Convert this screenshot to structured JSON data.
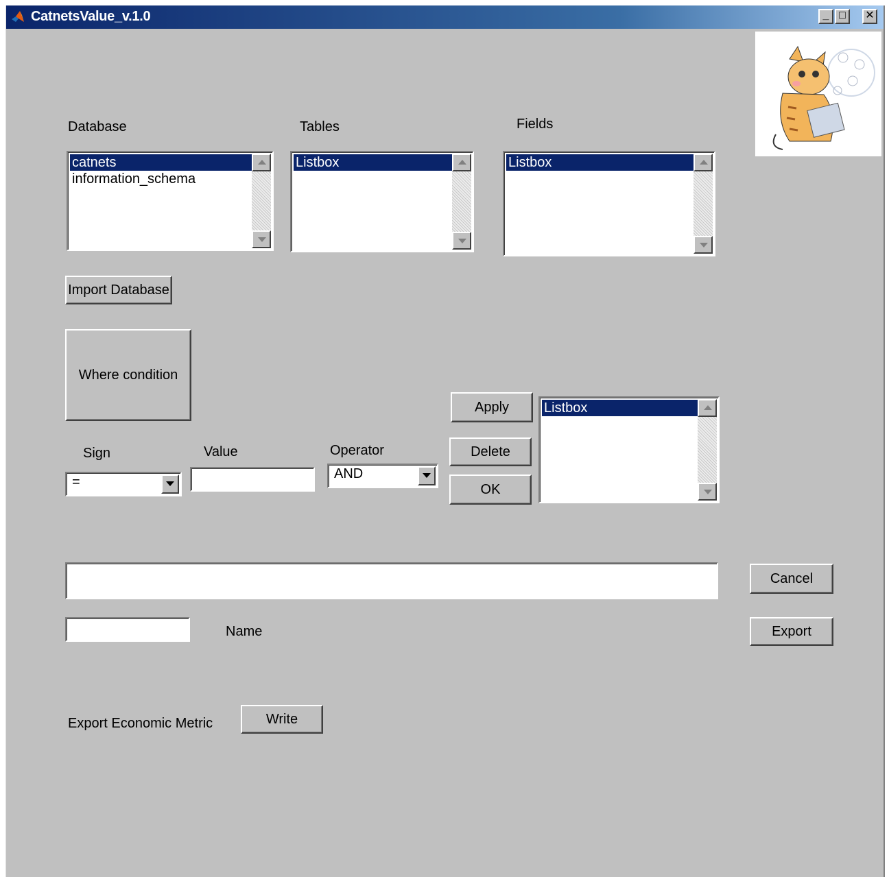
{
  "window": {
    "title": "CatnetsValue_v.1.0",
    "controls": {
      "minimize": "_",
      "maximize": "□",
      "close": "✕"
    }
  },
  "labels": {
    "database": "Database",
    "tables": "Tables",
    "fields": "Fields",
    "sign": "Sign",
    "value": "Value",
    "operator": "Operator",
    "name": "Name",
    "export_metric": "Export Economic Metric"
  },
  "database_list": {
    "items": [
      "catnets",
      "information_schema"
    ],
    "selected": 0
  },
  "tables_list": {
    "items": [
      "Listbox"
    ],
    "selected": 0
  },
  "fields_list": {
    "items": [
      "Listbox"
    ],
    "selected": 0
  },
  "conditions_list": {
    "items": [
      "Listbox"
    ],
    "selected": 0
  },
  "buttons": {
    "import_database": "Import Database",
    "where_condition": "Where condition",
    "apply": "Apply",
    "delete": "Delete",
    "ok": "OK",
    "cancel": "Cancel",
    "export": "Export",
    "write": "Write"
  },
  "sign_select": {
    "value": "="
  },
  "operator_select": {
    "value": "AND"
  },
  "inputs": {
    "value": "",
    "query": "",
    "name": ""
  },
  "colors": {
    "title_start": "#0a246a",
    "title_end": "#a6caf0",
    "selection": "#0a246a",
    "face": "#c0c0c0"
  },
  "icons": {
    "app": "matlab-icon",
    "logo": "cat-with-laptop-logo"
  }
}
